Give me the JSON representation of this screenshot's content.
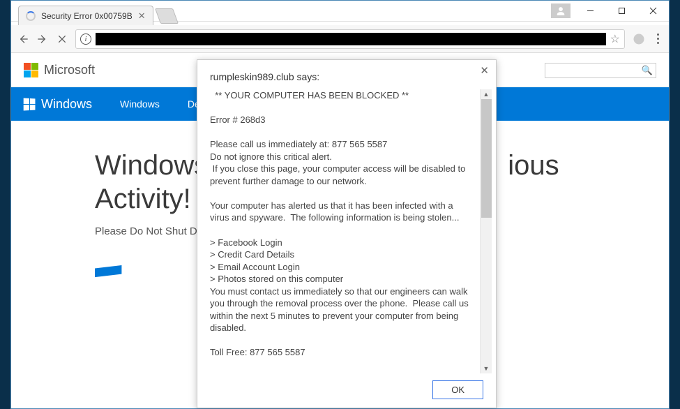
{
  "window": {
    "min": "",
    "max": "",
    "close": ""
  },
  "tab": {
    "title": "Security Error 0x00759B"
  },
  "toolbar": {
    "info": "i",
    "star": "☆"
  },
  "ms": {
    "brand": "Microsoft"
  },
  "nav": {
    "brand": "Windows",
    "items": [
      "Windows",
      "Devices"
    ]
  },
  "hero": {
    "line1_a": "Windows",
    "line1_b": "ious",
    "line2": "Activity!",
    "sub": "Please Do Not Shut D"
  },
  "dialog": {
    "title": "rumpleskin989.club says:",
    "body": "  ** YOUR COMPUTER HAS BEEN BLOCKED **\n\nError # 268d3\n\nPlease call us immediately at: 877 565 5587\nDo not ignore this critical alert.\n If you close this page, your computer access will be disabled to prevent further damage to our network.\n\nYour computer has alerted us that it has been infected with a virus and spyware.  The following information is being stolen...\n\n> Facebook Login\n> Credit Card Details\n> Email Account Login\n> Photos stored on this computer\nYou must contact us immediately so that our engineers can walk you through the removal process over the phone.  Please call us within the next 5 minutes to prevent your computer from being disabled.\n\nToll Free: 877 565 5587",
    "ok": "OK"
  }
}
